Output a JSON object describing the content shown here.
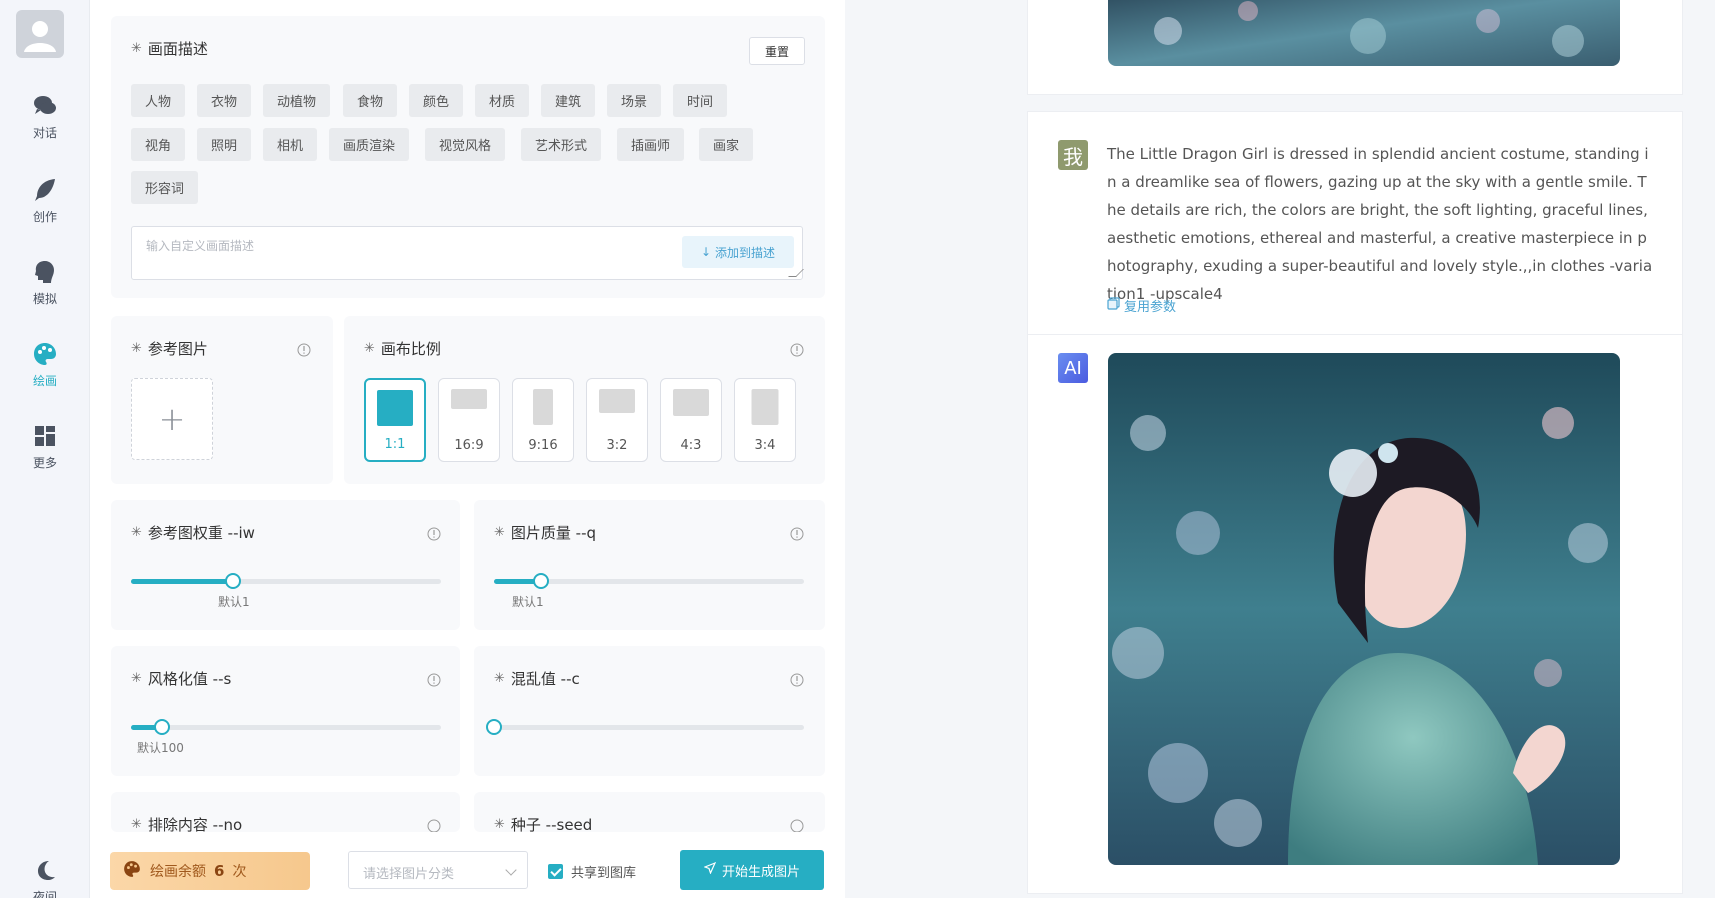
{
  "nav": {
    "items": [
      {
        "label": "对话",
        "icon": "chat-icon"
      },
      {
        "label": "创作",
        "icon": "feather-icon"
      },
      {
        "label": "模拟",
        "icon": "head-icon"
      },
      {
        "label": "绘画",
        "icon": "palette-icon",
        "active": true
      },
      {
        "label": "更多",
        "icon": "grid-icon"
      }
    ],
    "bottom_label": "夜间"
  },
  "description": {
    "title": "画面描述",
    "reset_label": "重置",
    "tags": [
      "人物",
      "衣物",
      "动植物",
      "食物",
      "颜色",
      "材质",
      "建筑",
      "场景",
      "时间",
      "视角",
      "照明",
      "相机",
      "画质渲染",
      "视觉风格",
      "艺术形式",
      "插画师",
      "画家",
      "形容词"
    ],
    "input_placeholder": "输入自定义画面描述",
    "add_label": "添加到描述"
  },
  "reference": {
    "title": "参考图片"
  },
  "ratio": {
    "title": "画布比例",
    "options": [
      "1:1",
      "16:9",
      "9:16",
      "3:2",
      "4:3",
      "3:4"
    ],
    "selected": "1:1"
  },
  "sliders": {
    "iw": {
      "title": "参考图权重 --iw",
      "hint": "默认1",
      "fraction": 0.33
    },
    "q": {
      "title": "图片质量 --q",
      "hint": "默认1",
      "fraction": 0.15
    },
    "s": {
      "title": "风格化值 --s",
      "hint": "默认100",
      "fraction": 0.1
    },
    "c": {
      "title": "混乱值 --c",
      "fraction": 0.0
    }
  },
  "more_params": {
    "no": {
      "title": "排除内容 --no"
    },
    "seed": {
      "title": "种子 --seed"
    }
  },
  "footer": {
    "balance_label": "绘画余额",
    "balance_count": "6",
    "balance_unit": "次",
    "category_placeholder": "请选择图片分类",
    "share_label": "共享到图库",
    "generate_label": "开始生成图片"
  },
  "chat": {
    "user_avatar_text": "我",
    "user_message": "The Little Dragon Girl is dressed in splendid ancient costume, standing in a dreamlike sea of flowers, gazing up at the sky with a gentle smile. The details are rich, the colors are bright, the soft lighting, graceful lines, aesthetic emotions, ethereal and masterful, a creative masterpiece in photography, exuding a super-beautiful and lovely style.,,in clothes -variation1 -upscale4",
    "reuse_label": "复用参数",
    "ai_avatar_text": "AI"
  },
  "colors": {
    "accent": "#26aec3",
    "balance_bg": "#f6c88d",
    "user_avatar_bg": "#8f9a6e",
    "ai_avatar_bg": "#4b7be0"
  }
}
